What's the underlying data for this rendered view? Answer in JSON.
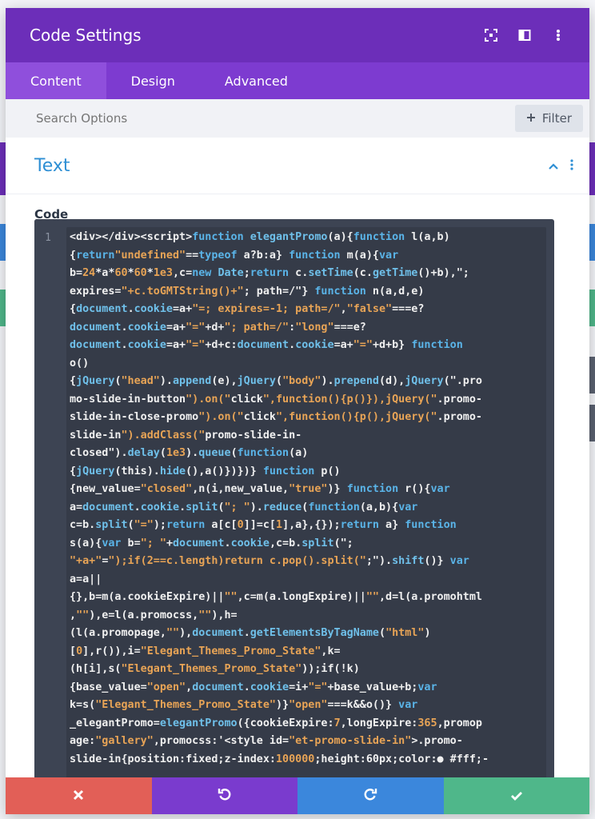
{
  "modal": {
    "title": "Code Settings",
    "header_icons": [
      "expand-icon",
      "split-view-icon",
      "more-vertical-icon"
    ]
  },
  "tabs": [
    {
      "label": "Content",
      "active": true
    },
    {
      "label": "Design",
      "active": false
    },
    {
      "label": "Advanced",
      "active": false
    }
  ],
  "search": {
    "placeholder": "Search Options",
    "filter_label": "Filter"
  },
  "section": {
    "title": "Text"
  },
  "field": {
    "label": "Code"
  },
  "editor": {
    "line_number": "1",
    "lines": [
      "<div></div><script>function elegantPromo(a){function l(a,b)",
      "{return\"undefined\"==typeof a?b:a} function m(a){var",
      "b=24*a*60*60*1e3,c=new Date;return c.setTime(c.getTime()+b),\";",
      "expires=\"+c.toGMTString()+\"; path=/\"} function n(a,d,e)",
      "{document.cookie=a+\"=; expires=-1; path=/\",\"false\"===e?",
      "document.cookie=a+\"=\"+d+\"; path=/\":\"long\"===e?",
      "document.cookie=a+\"=\"+d+c:document.cookie=a+\"=\"+d+b} function",
      "o()",
      "{jQuery(\"head\").append(e),jQuery(\"body\").prepend(d),jQuery(\".pro",
      "mo-slide-in-button\").on(\"click\",function(){p()}),jQuery(\".promo-",
      "slide-in-close-promo\").on(\"click\",function(){p(),jQuery(\".promo-",
      "slide-in\").addClass(\"promo-slide-in-",
      "closed\").delay(1e3).queue(function(a)",
      "{jQuery(this).hide(),a()})})} function p()",
      "{new_value=\"closed\",n(i,new_value,\"true\")} function r(){var",
      "a=document.cookie.split(\"; \").reduce(function(a,b){var",
      "c=b.split(\"=\");return a[c[0]]=c[1],a},{});return a} function",
      "s(a){var b=\"; \"+document.cookie,c=b.split(\";",
      "\"+a+\"=\");if(2==c.length)return c.pop().split(\";\").shift()} var",
      "a=a||",
      "{},b=m(a.cookieExpire)||\"\",c=m(a.longExpire)||\"\",d=l(a.promohtml",
      ",\"\"),e=l(a.promocss,\"\"),h=",
      "(l(a.promopage,\"\"),document.getElementsByTagName(\"html\")",
      "[0],r()),i=\"Elegant_Themes_Promo_State\",k=",
      "(h[i],s(\"Elegant_Themes_Promo_State\"));if(!k)",
      "{base_value=\"open\",document.cookie=i+\"=\"+base_value+b;var",
      "k=s(\"Elegant_Themes_Promo_State\")}\"open\"===k&&o()} var",
      "_elegantPromo=elegantPromo({cookieExpire:7,longExpire:365,promop",
      "age:\"gallery\",promocss:'<style id=\"et-promo-slide-in\">.promo-",
      "slide-in{position:fixed;z-index:100000;height:60px;color:● #fff;-"
    ]
  },
  "footer": {
    "buttons": [
      "close-icon",
      "undo-icon",
      "redo-icon",
      "check-icon"
    ]
  },
  "colors": {
    "header": "#6c2eb9",
    "tabs": "#7d3bd0",
    "accent": "#2e8fd4",
    "cancel": "#e25f57",
    "undo": "#7a3bce",
    "redo": "#3b87dc",
    "save": "#4fb78a"
  }
}
